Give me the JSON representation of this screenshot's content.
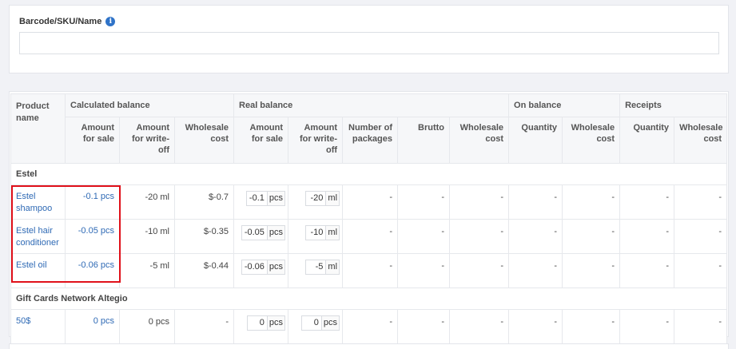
{
  "search": {
    "label": "Barcode/SKU/Name",
    "info_icon": "i",
    "value": "",
    "placeholder": ""
  },
  "table": {
    "header_groups": {
      "product_name": "Product name",
      "calculated_balance": "Calculated balance",
      "real_balance": "Real balance",
      "on_balance": "On balance",
      "receipts": "Receipts"
    },
    "columns": {
      "amount_for_sale": "Amount for sale",
      "amount_for_writeoff": "Amount for write-off",
      "wholesale_cost": "Wholesale cost",
      "real_amount_for_sale": "Amount for sale",
      "real_amount_for_writeoff": "Amount for write-off",
      "number_of_packages": "Number of packages",
      "brutto": "Brutto",
      "real_wholesale_cost": "Wholesale cost",
      "on_quantity": "Quantity",
      "on_wholesale_cost": "Wholesale cost",
      "rec_quantity": "Quantity",
      "rec_wholesale_cost": "Wholesale cost"
    },
    "groups": [
      {
        "name": "Estel",
        "rows": [
          {
            "name": "Estel shampoo",
            "sale": "-0.1 pcs",
            "writeoff": "-20 ml",
            "wholesale": "$-0.7",
            "real_sale": "-0.1",
            "real_sale_unit": "pcs",
            "real_writeoff": "-20",
            "real_writeoff_unit": "ml",
            "packages": "-",
            "brutto": "-",
            "real_wholesale": "-",
            "on_qty": "-",
            "on_wholesale": "-",
            "rec_qty": "-",
            "rec_wholesale": "-"
          },
          {
            "name": "Estel hair conditioner",
            "sale": "-0.05 pcs",
            "writeoff": "-10 ml",
            "wholesale": "$-0.35",
            "real_sale": "-0.05",
            "real_sale_unit": "pcs",
            "real_writeoff": "-10",
            "real_writeoff_unit": "ml",
            "packages": "-",
            "brutto": "-",
            "real_wholesale": "-",
            "on_qty": "-",
            "on_wholesale": "-",
            "rec_qty": "-",
            "rec_wholesale": "-"
          },
          {
            "name": "Estel oil",
            "sale": "-0.06 pcs",
            "writeoff": "-5 ml",
            "wholesale": "$-0.44",
            "real_sale": "-0.06",
            "real_sale_unit": "pcs",
            "real_writeoff": "-5",
            "real_writeoff_unit": "ml",
            "packages": "-",
            "brutto": "-",
            "real_wholesale": "-",
            "on_qty": "-",
            "on_wholesale": "-",
            "rec_qty": "-",
            "rec_wholesale": "-"
          }
        ]
      },
      {
        "name": "Gift Cards Network Altegio",
        "rows": [
          {
            "name": "50$",
            "sale": "0 pcs",
            "writeoff": "0 pcs",
            "wholesale": "-",
            "real_sale": "0",
            "real_sale_unit": "pcs",
            "real_writeoff": "0",
            "real_writeoff_unit": "pcs",
            "packages": "-",
            "brutto": "-",
            "real_wholesale": "-",
            "on_qty": "-",
            "on_wholesale": "-",
            "rec_qty": "-",
            "rec_wholesale": "-"
          }
        ]
      }
    ]
  },
  "colors": {
    "link": "#2f6ab5",
    "highlight_border": "#e0101a",
    "info_icon": "#2f73c8",
    "background": "#f1f2f6"
  }
}
